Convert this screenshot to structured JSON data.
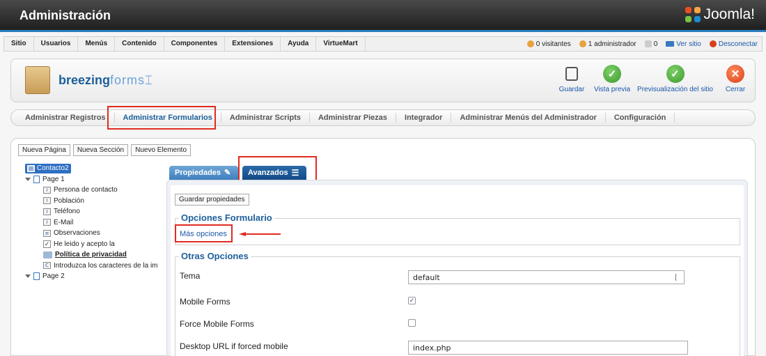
{
  "header": {
    "title": "Administración",
    "logo_text": "Joomla!"
  },
  "menu": {
    "items": [
      "Sitio",
      "Usuarios",
      "Menús",
      "Contenido",
      "Componentes",
      "Extensiones",
      "Ayuda",
      "VirtueMart"
    ],
    "status": {
      "visitors": "0 visitantes",
      "admins": "1 administrador",
      "messages": "0",
      "view_site": "Ver sitio",
      "logout": "Desconectar"
    }
  },
  "toolbar": {
    "brand_bold": "breezing",
    "brand_light": "forms",
    "save": "Guardar",
    "preview": "Vista previa",
    "site_preview": "Previsualización del sitio",
    "close": "Cerrar"
  },
  "tabs": [
    "Administrar Registros",
    "Administrar Formularios",
    "Administrar Scripts",
    "Administrar Piezas",
    "Integrador",
    "Administrar Menús del Administrador",
    "Configuración"
  ],
  "actions": {
    "new_page": "Nueva Página",
    "new_section": "Nueva Sección",
    "new_element": "Nuevo Elemento"
  },
  "tree": {
    "root": "Contacto2",
    "page1": "Page 1",
    "items": [
      "Persona de contacto",
      "Población",
      "Teléfono",
      "E-Mail",
      "Observaciones",
      "He leido y acepto la",
      "Política de privacidad",
      "Introduzca los caracteres de la im"
    ],
    "page2": "Page 2"
  },
  "props": {
    "tab_properties": "Propiedades",
    "tab_advanced": "Avanzados",
    "save_button": "Guardar propiedades",
    "form_options_legend": "Opciones Formulario",
    "more_options": "Más opciones",
    "other_options_legend": "Otras Opciones",
    "theme_label": "Tema",
    "theme_value": "default",
    "mobile_forms_label": "Mobile Forms",
    "mobile_forms_checked": true,
    "force_mobile_label": "Force Mobile Forms",
    "force_mobile_checked": false,
    "desktop_url_label": "Desktop URL if forced mobile",
    "desktop_url_value": "index.php"
  },
  "colors": {
    "accent": "#1d5f9b",
    "highlight": "#e02b20",
    "header_bg": "#2b2b2b"
  }
}
